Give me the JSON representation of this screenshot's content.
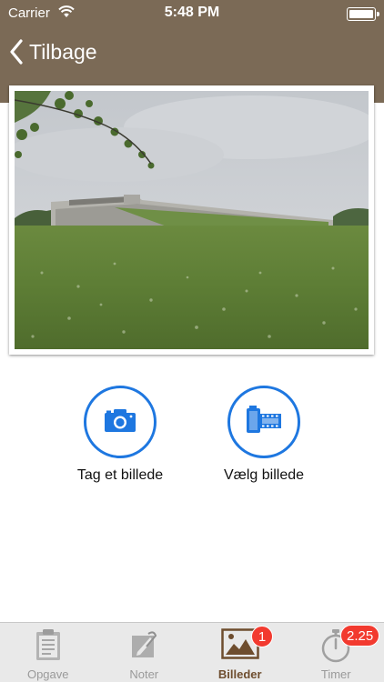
{
  "status_bar": {
    "carrier": "Carrier",
    "time": "5:48 PM"
  },
  "nav": {
    "back_label": "Tilbage"
  },
  "actions": {
    "take_photo": {
      "label": "Tag et billede",
      "icon": "camera-icon"
    },
    "choose_photo": {
      "label": "Vælg billede",
      "icon": "film-roll-icon"
    }
  },
  "tabs": [
    {
      "label": "Opgave",
      "icon": "clipboard-icon",
      "active": false
    },
    {
      "label": "Noter",
      "icon": "notes-icon",
      "active": false
    },
    {
      "label": "Billeder",
      "icon": "photo-icon",
      "active": true,
      "badge": "1"
    },
    {
      "label": "Timer",
      "icon": "stopwatch-icon",
      "active": false,
      "badge": "2.25"
    }
  ],
  "colors": {
    "header": "#7b6a56",
    "accent": "#1e77e0",
    "badge": "#f23a2f",
    "active_tab": "#6e4d2e"
  }
}
